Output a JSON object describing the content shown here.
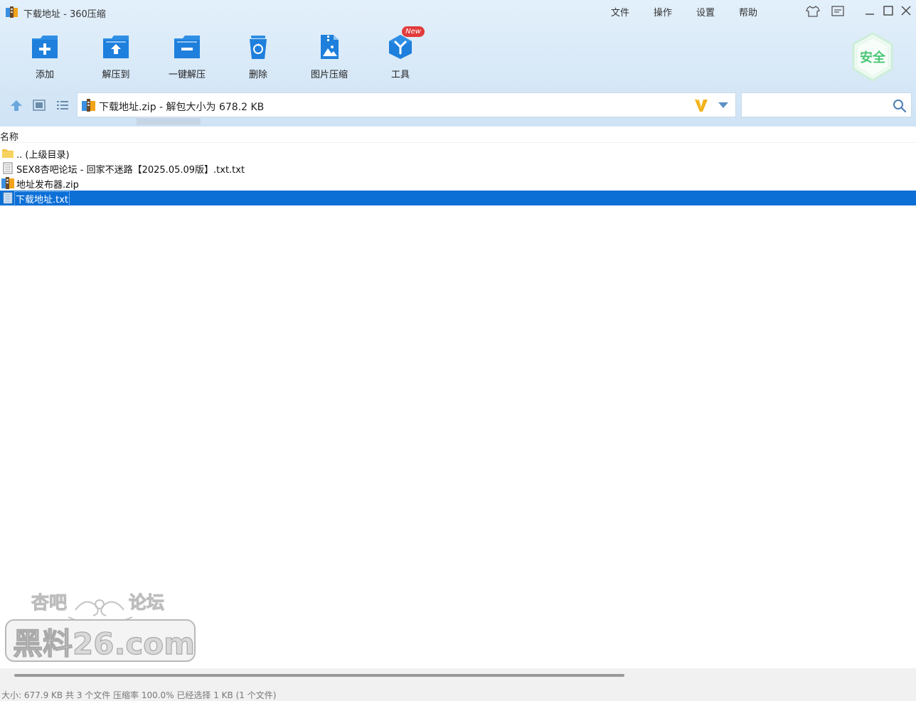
{
  "window": {
    "title": "下载地址 - 360压缩"
  },
  "menu": {
    "file": "文件",
    "operate": "操作",
    "settings": "设置",
    "help": "帮助"
  },
  "toolbar": {
    "add": "添加",
    "extract_to": "解压到",
    "one_click_extract": "一键解压",
    "delete": "删除",
    "image_compress": "图片压缩",
    "tools": "工具",
    "new_badge": "New"
  },
  "security": {
    "label": "安全"
  },
  "path": {
    "text": "下载地址.zip - 解包大小为 678.2 KB"
  },
  "search": {
    "value": "",
    "placeholder": ""
  },
  "columns": {
    "name": "名称"
  },
  "files": [
    {
      "name": ".. (上级目录)",
      "icon": "folder-icon",
      "selected": false
    },
    {
      "name": "SEX8杏吧论坛 - 回家不迷路【2025.05.09版】.txt.txt",
      "icon": "text-file-icon",
      "selected": false
    },
    {
      "name": "地址发布器.zip",
      "icon": "zip-file-icon",
      "selected": false
    },
    {
      "name": "下载地址.txt",
      "icon": "text-file-icon",
      "selected": true
    }
  ],
  "watermark": {
    "line1_left": "杏吧",
    "line1_right": "论坛",
    "line2": "黑料26.com"
  },
  "status": {
    "text": "大小: 677.9 KB 共 3 个文件 压缩率 100.0% 已经选择 1 KB (1 个文件)"
  },
  "colors": {
    "header_bg": "#d7e8f7",
    "selection": "#0b6fd6",
    "accent_blue": "#2f8fe6",
    "safe_green": "#4cc776",
    "badge_red": "#e33b3b"
  }
}
